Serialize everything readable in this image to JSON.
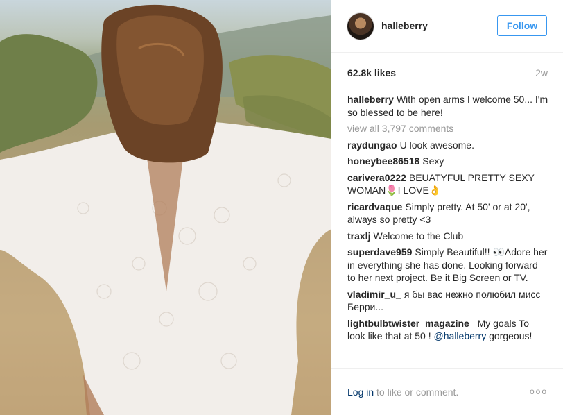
{
  "post": {
    "username": "halleberry",
    "follow_label": "Follow",
    "likes": "62.8k likes",
    "time_ago": "2w",
    "caption": "With open arms I welcome 50... I'm so blessed to be here!",
    "view_all": "view all 3,797 comments"
  },
  "comments": [
    {
      "user": "raydungao",
      "text": "U look awesome."
    },
    {
      "user": "honeybee86518",
      "text": "Sexy"
    },
    {
      "user": "carivera0222",
      "text": "BEUATYFUL PRETTY SEXY WOMAN🌷I LOVE👌"
    },
    {
      "user": "ricardvaque",
      "text": "Simply pretty. At 50' or at 20', always so pretty <3"
    },
    {
      "user": "traxlj",
      "text": "Welcome to the Club"
    },
    {
      "user": "superdave959",
      "text": "Simply Beautiful!! 👀Adore her in everything she has done. Looking forward to her next project. Be it Big Screen or TV."
    },
    {
      "user": "vladimir_u_",
      "text": "я бы вас нежно полюбил мисс Берри..."
    },
    {
      "user": "lightbulbtwister_magazine_",
      "text": "My goals To look like that at 50 !",
      "mention": "@halleberry",
      "after": "gorgeous!"
    }
  ],
  "footer": {
    "login_link": "Log in",
    "login_text": "to like or comment.",
    "more": "ooo"
  },
  "colors": {
    "accent": "#3897f0",
    "link": "#003569",
    "muted": "#999999"
  }
}
